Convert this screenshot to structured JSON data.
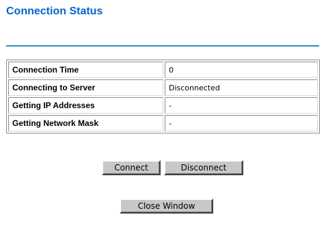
{
  "page": {
    "title": "Connection Status"
  },
  "status": {
    "rows": [
      {
        "label": "Connection Time",
        "value": "0"
      },
      {
        "label": "Connecting to Server",
        "value": "Disconnected"
      },
      {
        "label": "Getting IP Addresses",
        "value": "-"
      },
      {
        "label": "Getting Network Mask",
        "value": "-"
      }
    ]
  },
  "buttons": {
    "connect_label": "Connect",
    "disconnect_label": "Disconnect",
    "close_label": "Close Window"
  },
  "colors": {
    "title": "#0066cc",
    "rule": "#2a8fc9",
    "button_face": "#c8c8c8"
  }
}
